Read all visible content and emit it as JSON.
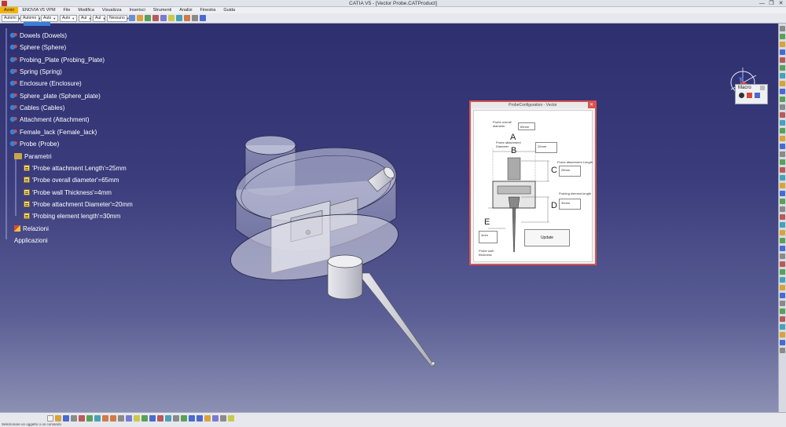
{
  "window": {
    "title": "CATIA V5 - [Vector Probe.CATProduct]",
    "controls": [
      "—",
      "❐",
      "✕"
    ]
  },
  "menu": [
    "Avvio",
    "ENOVIA V5 VPM",
    "File",
    "Modifica",
    "Visualizza",
    "Inserisci",
    "Strumenti",
    "Analisi",
    "Finestra",
    "Guida"
  ],
  "toolbar": {
    "combos": [
      "Automi",
      "Automo",
      "Auto",
      "Auto",
      "Aut",
      "Aut",
      "Nessuno"
    ]
  },
  "tree": {
    "items": [
      {
        "label": "Dowels (Dowels)"
      },
      {
        "label": "Sphere (Sphere)"
      },
      {
        "label": "Probing_Plate (Probing_Plate)"
      },
      {
        "label": "Spring (Spring)"
      },
      {
        "label": "Enclosure (Enclosure)"
      },
      {
        "label": "Sphere_plate (Sphere_plate)"
      },
      {
        "label": "Cables (Cables)"
      },
      {
        "label": "Attachment (Attachment)"
      },
      {
        "label": "Female_lack (Female_lack)"
      },
      {
        "label": "Probe (Probe)"
      }
    ],
    "parameters_label": "Parametri",
    "parameters": [
      "'Probe attachment Length'=25mm",
      "'Probe overall diameter'=65mm",
      "'Probe wall Thickness'=4mm",
      "'Probe attachment Diameter'=20mm",
      "'Probing element length'=30mm"
    ],
    "relations_label": "Relazioni",
    "applications_label": "Applicazioni"
  },
  "macro": {
    "title": "Macro"
  },
  "dialog": {
    "title": "ProbeConfiguration - Vector",
    "labels": {
      "overall_diameter": "Probe overall diameter",
      "attachment_diameter": "Probe attachment Diameter",
      "attachment_length": "Probe attachment Length",
      "element_length": "Probing element length",
      "wall_thickness": "Probe wall thickness"
    },
    "letters": {
      "a": "A",
      "b": "B",
      "c": "C",
      "d": "D",
      "e": "E"
    },
    "values": {
      "overall_diameter": "65mm",
      "attachment_diameter": "20mm",
      "attachment_length": "25mm",
      "element_length": "30mm",
      "wall_thickness": "4mm"
    },
    "update_label": "Update"
  },
  "status": {
    "message": "Selezionare un oggetto o un comando"
  }
}
